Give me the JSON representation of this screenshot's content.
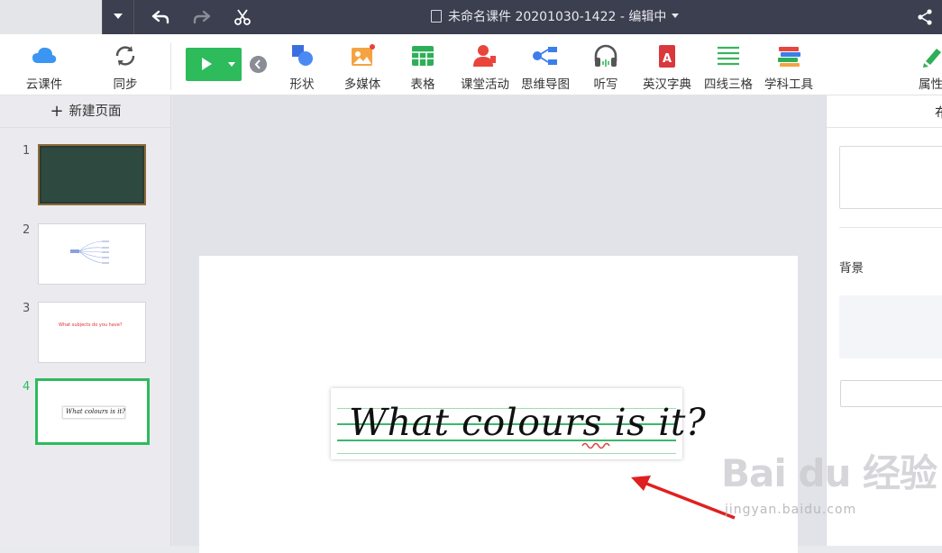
{
  "titlebar": {
    "doc_title": "未命名课件 20201030-1422 - 编辑中"
  },
  "toolbar": {
    "cloud_label": "云课件",
    "sync_label": "同步",
    "tools": [
      {
        "label": "形状"
      },
      {
        "label": "多媒体"
      },
      {
        "label": "表格"
      },
      {
        "label": "课堂活动"
      },
      {
        "label": "思维导图"
      },
      {
        "label": "听写"
      },
      {
        "label": "英汉字典"
      },
      {
        "label": "四线三格"
      },
      {
        "label": "学科工具"
      }
    ],
    "properties_label": "属性"
  },
  "leftpanel": {
    "new_page_label": "新建页面",
    "slides": [
      {
        "num": "1"
      },
      {
        "num": "2"
      },
      {
        "num": "3",
        "text": "What subjects do you have?"
      },
      {
        "num": "4",
        "text": "What colours is it?"
      }
    ]
  },
  "canvas": {
    "fourline_text": "What colours is it?"
  },
  "rightpanel": {
    "header": "布",
    "background_label": "背景"
  },
  "watermark": {
    "text": "Bai du 经验",
    "sub": "jingyan.baidu.com"
  },
  "colors": {
    "titlebar": "#3c3f4f",
    "accent_green": "#2dbb5c",
    "annotation_red": "#e02020"
  }
}
